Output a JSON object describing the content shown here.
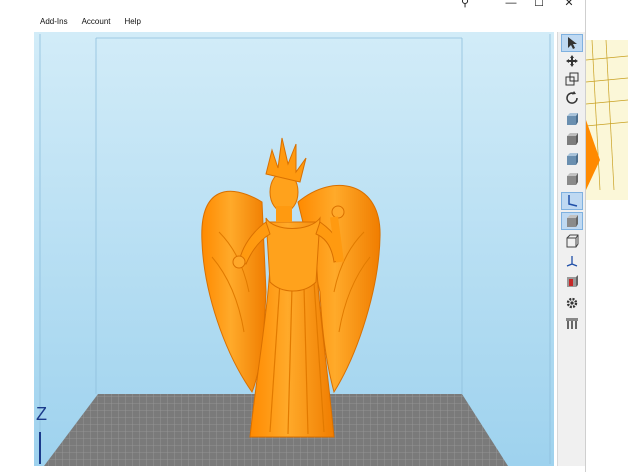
{
  "window": {
    "close_glyph": "✕",
    "maximize_glyph": "☐",
    "minimize_glyph": "—"
  },
  "menu": {
    "items": [
      {
        "label": "Add-Ins"
      },
      {
        "label": "Account"
      },
      {
        "label": "Help"
      }
    ]
  },
  "viewport": {
    "background_top": "#cde8f6",
    "background_bottom": "#9fd3ef",
    "model_color": "#ff9a10",
    "bed_color": "#777777",
    "axis_label": "Z"
  },
  "toolbar": {
    "tools": [
      {
        "name": "select-tool",
        "icon": "arrow-pointer-icon",
        "active": true
      },
      {
        "name": "move-tool",
        "icon": "move-arrows-icon",
        "active": false
      },
      {
        "name": "scale-tool",
        "icon": "scale-icon",
        "active": false
      },
      {
        "name": "rotate-tool",
        "icon": "rotate-icon",
        "active": false
      },
      {
        "name": "view-front-tool",
        "icon": "cube-front-icon",
        "active": false
      },
      {
        "name": "view-back-tool",
        "icon": "cube-back-icon",
        "active": false
      },
      {
        "name": "view-left-tool",
        "icon": "cube-left-icon",
        "active": false
      },
      {
        "name": "view-right-tool",
        "icon": "cube-right-icon",
        "active": false
      },
      {
        "name": "view-iso-tool",
        "icon": "axis-iso-icon",
        "active": true
      },
      {
        "name": "view-solid-tool",
        "icon": "cube-solid-icon",
        "active": true
      },
      {
        "name": "view-wireframe-tool",
        "icon": "cube-wireframe-icon",
        "active": false
      },
      {
        "name": "axis-tool",
        "icon": "axis-icon",
        "active": false
      },
      {
        "name": "section-tool",
        "icon": "section-cube-icon",
        "active": false
      },
      {
        "name": "settings-tool",
        "icon": "gear-icon",
        "active": false
      },
      {
        "name": "supports-tool",
        "icon": "supports-icon",
        "active": false
      }
    ]
  }
}
